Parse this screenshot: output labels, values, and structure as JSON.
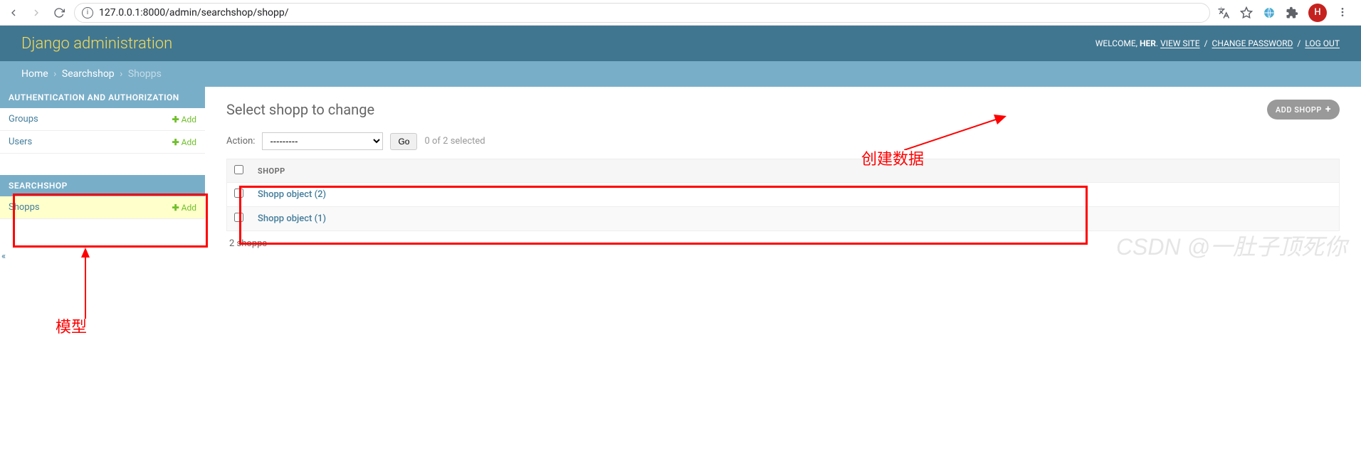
{
  "browser": {
    "url": "127.0.0.1:8000/admin/searchshop/shopp/",
    "avatar_letter": "H"
  },
  "header": {
    "branding": "Django administration",
    "welcome": "WELCOME,",
    "username": "HER",
    "view_site": "VIEW SITE",
    "change_password": "CHANGE PASSWORD",
    "logout": "LOG OUT"
  },
  "breadcrumbs": {
    "home": "Home",
    "app": "Searchshop",
    "current": "Shopps"
  },
  "sidebar": {
    "modules": [
      {
        "caption": "AUTHENTICATION AND AUTHORIZATION",
        "rows": [
          {
            "name": "Groups",
            "add_label": "Add",
            "active": false
          },
          {
            "name": "Users",
            "add_label": "Add",
            "active": false
          }
        ]
      },
      {
        "caption": "SEARCHSHOP",
        "rows": [
          {
            "name": "Shopps",
            "add_label": "Add",
            "active": true
          }
        ]
      }
    ]
  },
  "main": {
    "title": "Select shopp to change",
    "add_button": "ADD SHOPP",
    "action_label": "Action:",
    "action_placeholder": "---------",
    "go_label": "Go",
    "selection_count": "0 of 2 selected",
    "table_header": "SHOPP",
    "rows": [
      {
        "label": "Shopp object (2)"
      },
      {
        "label": "Shopp object (1)"
      }
    ],
    "paginator": "2 shopps"
  },
  "annotations": {
    "model_label": "模型",
    "create_label": "创建数据",
    "watermark": "CSDN @一肚子顶死你"
  }
}
